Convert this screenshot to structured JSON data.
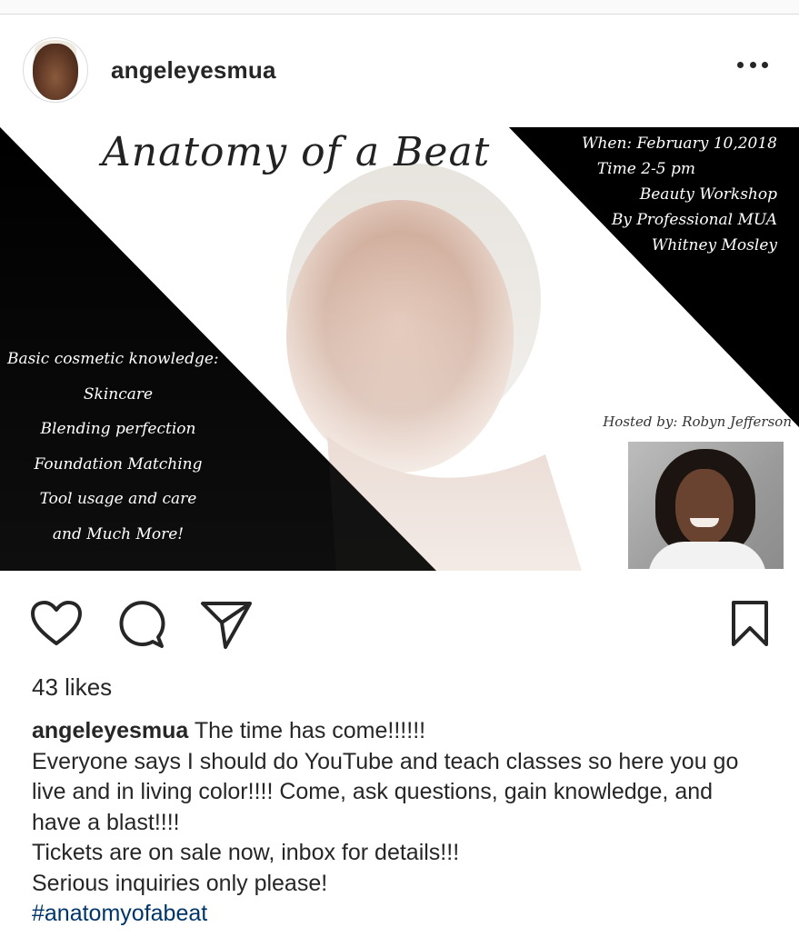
{
  "post": {
    "username": "angeleyesmua",
    "likes": "43 likes"
  },
  "flyer": {
    "title": "Anatomy of a Beat",
    "details": [
      "When: February 10,2018",
      "Time 2-5 pm",
      "Beauty Workshop",
      "By Professional MUA",
      "Whitney Mosley"
    ],
    "skills": [
      "Basic cosmetic knowledge:",
      "Skincare",
      "Blending perfection",
      "Foundation Matching",
      "Tool usage and care",
      "and Much More!"
    ],
    "hosted_by": "Hosted by: Robyn Jefferson"
  },
  "caption": {
    "username": "angeleyesmua",
    "first_line": "The time has come!!!!!!",
    "body_lines": [
      "Everyone says I should do YouTube and teach classes so here you go live and in living color!!!! Come, ask questions, gain knowledge, and have a blast!!!!",
      "Tickets are on sale now, inbox for details!!!",
      "Serious inquiries only please!"
    ],
    "hashtag": "#anatomyofabeat"
  },
  "icons": {
    "like": "heart-icon",
    "comment": "comment-icon",
    "share": "paper-plane-icon",
    "save": "bookmark-icon",
    "more": "more-dots-icon"
  }
}
